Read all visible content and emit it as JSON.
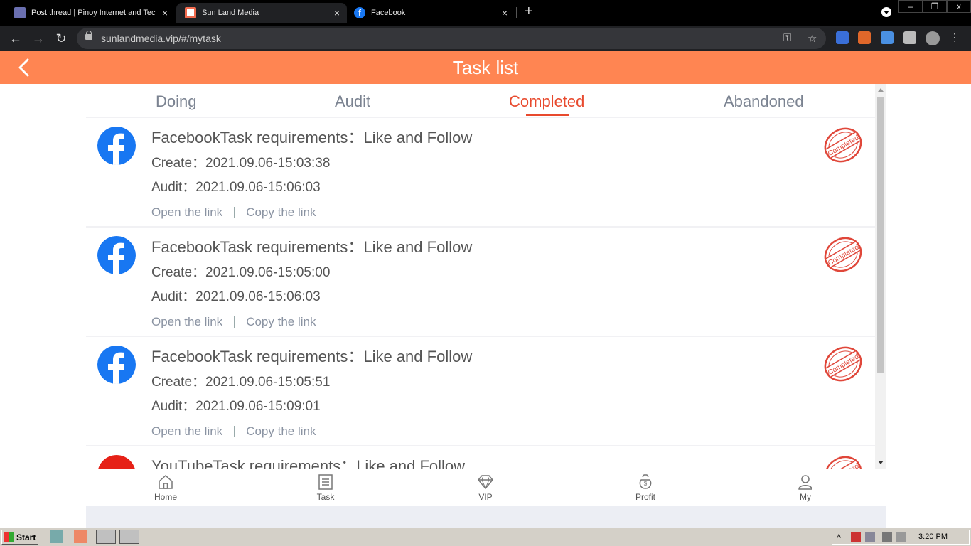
{
  "browser": {
    "tabs": [
      {
        "title": "Post thread | Pinoy Internet and Tec",
        "active": false
      },
      {
        "title": "Sun Land Media",
        "active": true
      },
      {
        "title": "Facebook",
        "active": false
      }
    ],
    "new_tab": "+",
    "close": "×",
    "url": "sunlandmedia.vip/#/mytask",
    "window_buttons": [
      "–",
      "❐",
      "x"
    ]
  },
  "header": {
    "title": "Task list"
  },
  "status_tabs": [
    {
      "label": "Doing",
      "active": false
    },
    {
      "label": "Audit",
      "active": false
    },
    {
      "label": "Completed",
      "active": true
    },
    {
      "label": "Abandoned",
      "active": false
    }
  ],
  "tasks": [
    {
      "platform": "facebook",
      "title": "FacebookTask requirements：Like and Follow",
      "create": "Create：2021.09.06-15:03:38",
      "audit": "Audit：2021.09.06-15:06:03",
      "open": "Open the link",
      "copy": "Copy the link",
      "stamp": "Completed"
    },
    {
      "platform": "facebook",
      "title": "FacebookTask requirements：Like and Follow",
      "create": "Create：2021.09.06-15:05:00",
      "audit": "Audit：2021.09.06-15:06:03",
      "open": "Open the link",
      "copy": "Copy the link",
      "stamp": "Completed"
    },
    {
      "platform": "facebook",
      "title": "FacebookTask requirements：Like and Follow",
      "create": "Create：2021.09.06-15:05:51",
      "audit": "Audit：2021.09.06-15:09:01",
      "open": "Open the link",
      "copy": "Copy the link",
      "stamp": "Completed"
    },
    {
      "platform": "youtube",
      "title": "YouTubeTask requirements：Like and Follow",
      "stamp": "Completed"
    }
  ],
  "bottom_nav": [
    {
      "label": "Home",
      "icon": "home-icon"
    },
    {
      "label": "Task",
      "icon": "task-list-icon"
    },
    {
      "label": "VIP",
      "icon": "diamond-icon"
    },
    {
      "label": "Profit",
      "icon": "money-bag-icon"
    },
    {
      "label": "My",
      "icon": "user-icon"
    }
  ],
  "taskbar": {
    "start": "Start",
    "clock": "3:20 PM"
  },
  "colors": {
    "header": "#ff8552",
    "active_tab": "#e84a2e",
    "facebook": "#1877f2",
    "youtube": "#e62117",
    "stamp": "#e0473a"
  }
}
